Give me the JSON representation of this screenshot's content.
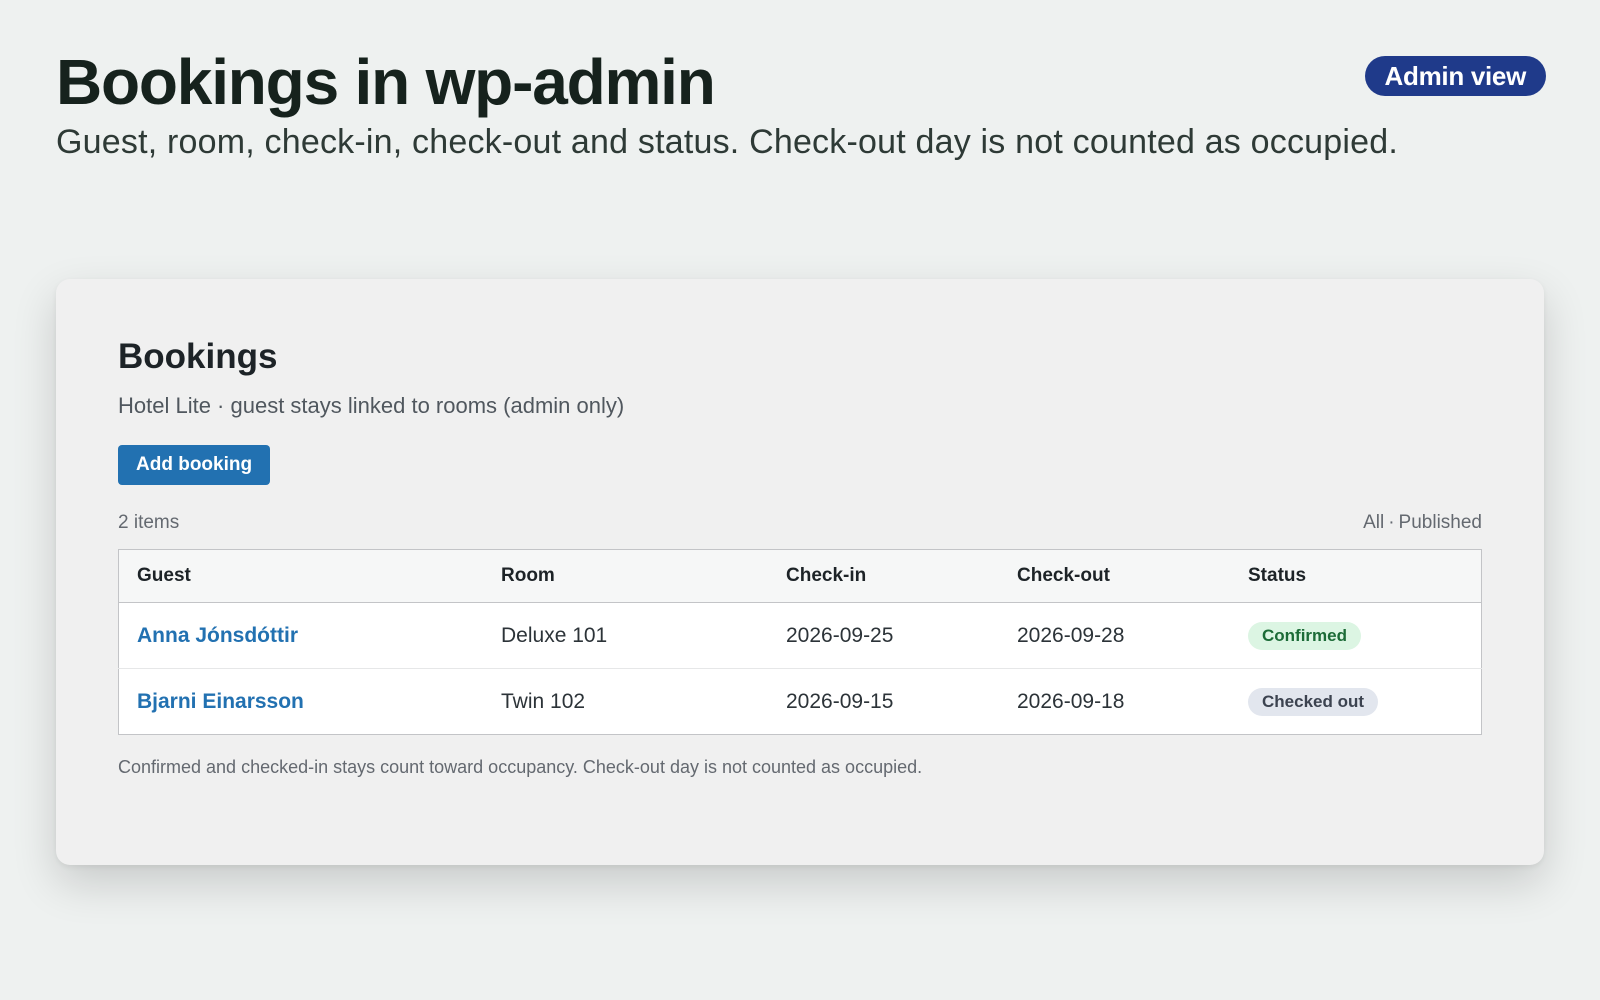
{
  "header": {
    "title": "Bookings in wp-admin",
    "subtitle": "Guest, room, check-in, check-out and status. Check-out day is not counted as occupied.",
    "badge": "Admin view"
  },
  "panel": {
    "title": "Bookings",
    "subtitle": "Hotel Lite · guest stays linked to rooms (admin only)",
    "add_button_label": "Add booking",
    "item_count": "2 items",
    "filters": [
      "All",
      "Published"
    ],
    "filter_separator": "·",
    "columns": {
      "guest": "Guest",
      "room": "Room",
      "checkin": "Check-in",
      "checkout": "Check-out",
      "status": "Status"
    },
    "rows": [
      {
        "guest": "Anna Jónsdóttir",
        "room": "Deluxe 101",
        "checkin": "2026-09-25",
        "checkout": "2026-09-28",
        "status": "Confirmed"
      },
      {
        "guest": "Bjarni Einarsson",
        "room": "Twin 102",
        "checkin": "2026-09-15",
        "checkout": "2026-09-18",
        "status": "Checked out"
      }
    ],
    "footnote": "Confirmed and checked-in stays count toward occupancy. Check-out day is not counted as occupied."
  },
  "colors": {
    "accent": "#2271b1",
    "badge": "#1f3a8a",
    "status_confirmed_bg": "#dcf5e3",
    "status_confirmed_text": "#1c6b37",
    "status_checkedout_bg": "#e2e6ee",
    "status_checkedout_text": "#3c4350"
  }
}
